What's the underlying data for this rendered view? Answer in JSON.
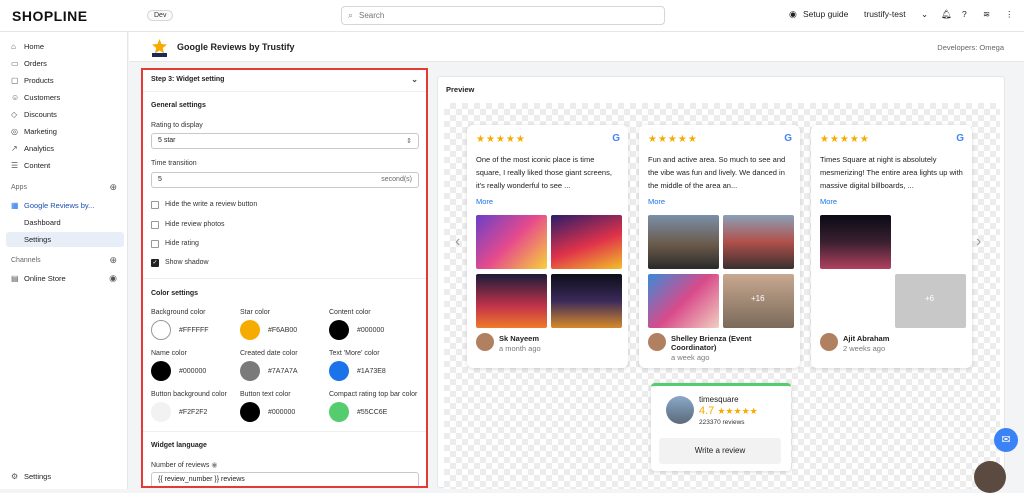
{
  "topbar": {
    "logo": "SHOPLINE",
    "env": "Dev",
    "search_placeholder": "Search",
    "setup_guide": "Setup guide",
    "store": "trustify-test"
  },
  "sidebar": {
    "items": [
      {
        "label": "Home"
      },
      {
        "label": "Orders"
      },
      {
        "label": "Products"
      },
      {
        "label": "Customers"
      },
      {
        "label": "Discounts"
      },
      {
        "label": "Marketing"
      },
      {
        "label": "Analytics"
      },
      {
        "label": "Content"
      }
    ],
    "apps_title": "Apps",
    "app_name": "Google Reviews by...",
    "app_sub": [
      {
        "label": "Dashboard"
      },
      {
        "label": "Settings"
      }
    ],
    "channels_title": "Channels",
    "channel": "Online Store",
    "settings": "Settings"
  },
  "appbar": {
    "title": "Google Reviews by Trustify",
    "developer": "Developers:  Omega"
  },
  "panel": {
    "step": "Step 3: Widget setting",
    "general": "General settings",
    "rating_label": "Rating to display",
    "rating_value": "5 star",
    "transition_label": "Time transition",
    "transition_value": "5",
    "transition_unit": "second(s)",
    "checks": [
      {
        "label": "Hide the write a review button",
        "checked": false
      },
      {
        "label": "Hide review photos",
        "checked": false
      },
      {
        "label": "Hide rating",
        "checked": false
      },
      {
        "label": "Show shadow",
        "checked": true
      }
    ],
    "color_title": "Color settings",
    "colors": [
      {
        "label": "Background color",
        "hex": "#FFFFFF"
      },
      {
        "label": "Star color",
        "hex": "#F6AB00"
      },
      {
        "label": "Content color",
        "hex": "#000000"
      },
      {
        "label": "Name color",
        "hex": "#000000"
      },
      {
        "label": "Created date color",
        "hex": "#7A7A7A"
      },
      {
        "label": "Text 'More' color",
        "hex": "#1A73E8"
      },
      {
        "label": "Button background color",
        "hex": "#F2F2F2"
      },
      {
        "label": "Button text color",
        "hex": "#000000"
      },
      {
        "label": "Compact rating top bar color",
        "hex": "#55CC6E"
      }
    ],
    "lang_title": "Widget language",
    "num_reviews_label": "Number of reviews",
    "num_reviews_value": "{{ review_number }} reviews"
  },
  "preview": {
    "title": "Preview",
    "cards": [
      {
        "text": "One of the most iconic place is time square, I really liked those giant screens, it's really wonderful to see ...",
        "more": "More",
        "name": "Sk Nayeem",
        "date": "a month ago",
        "extra": ""
      },
      {
        "text": "Fun and active area. So much to see and the vibe was fun and lively. We danced in the middle of the area an...",
        "more": "More",
        "name": "Shelley Brienza (Event Coordinator)",
        "date": "a week ago",
        "extra": "+16"
      },
      {
        "text": "Times Square at night is absolutely mesmerizing! The entire area lights up with massive digital billboards, ...",
        "more": "More",
        "name": "Ajit Abraham",
        "date": "2 weeks ago",
        "extra": "+6"
      }
    ],
    "compact": {
      "name": "timesquare",
      "rating": "4.7",
      "reviews": "223370 reviews",
      "button": "Write a review"
    }
  }
}
